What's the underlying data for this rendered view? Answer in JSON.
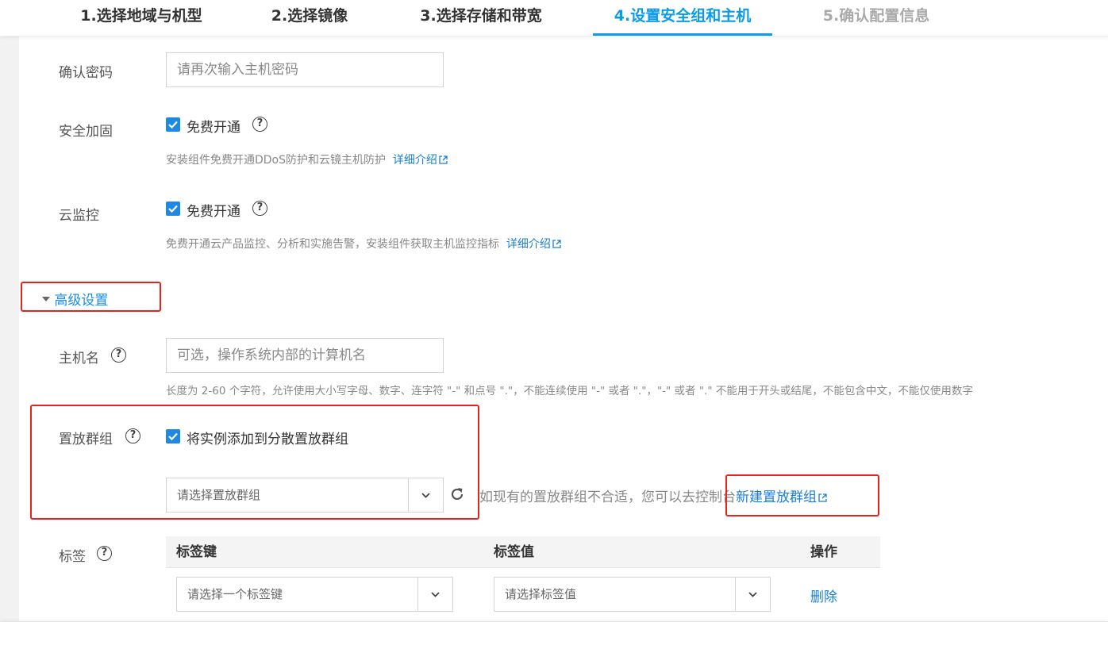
{
  "steps": [
    {
      "label": "1.选择地域与机型",
      "state": "done"
    },
    {
      "label": "2.选择镜像",
      "state": "done"
    },
    {
      "label": "3.选择存储和带宽",
      "state": "done"
    },
    {
      "label": "4.设置安全组和主机",
      "state": "active"
    },
    {
      "label": "5.确认配置信息",
      "state": "disabled"
    }
  ],
  "confirm_password": {
    "label": "确认密码",
    "placeholder": "请再次输入主机密码"
  },
  "security_hardening": {
    "label": "安全加固",
    "checkbox_label": "免费开通",
    "checked": true,
    "hint": "安装组件免费开通DDoS防护和云镜主机防护",
    "link": "详细介绍"
  },
  "cloud_monitor": {
    "label": "云监控",
    "checkbox_label": "免费开通",
    "checked": true,
    "hint": "免费开通云产品监控、分析和实施告警，安装组件获取主机监控指标",
    "link": "详细介绍"
  },
  "advanced": {
    "toggle_label": "高级设置",
    "expanded": true
  },
  "hostname": {
    "label": "主机名",
    "placeholder": "可选，操作系统内部的计算机名",
    "hint": "长度为 2-60 个字符，允许使用大小写字母、数字、连字符 \"-\" 和点号 \".\"，不能连续使用 \"-\" 或者 \".\"，\"-\" 或者 \".\" 不能用于开头或结尾，不能包含中文，不能仅使用数字"
  },
  "placement_group": {
    "label": "置放群组",
    "checkbox_label": "将实例添加到分散置放群组",
    "checked": true,
    "select_placeholder": "请选择置放群组",
    "hint": "如现有的置放群组不合适，您可以去控制台",
    "link": "新建置放群组"
  },
  "tags": {
    "label": "标签",
    "columns": [
      "标签键",
      "标签值",
      "操作"
    ],
    "key_placeholder": "请选择一个标签键",
    "value_placeholder": "请选择标签值",
    "delete_label": "删除"
  },
  "colors": {
    "accent": "#0a9bea",
    "link": "#1a7fd3",
    "checkbox": "#1e88e5",
    "highlight_box": "#e8231c"
  }
}
